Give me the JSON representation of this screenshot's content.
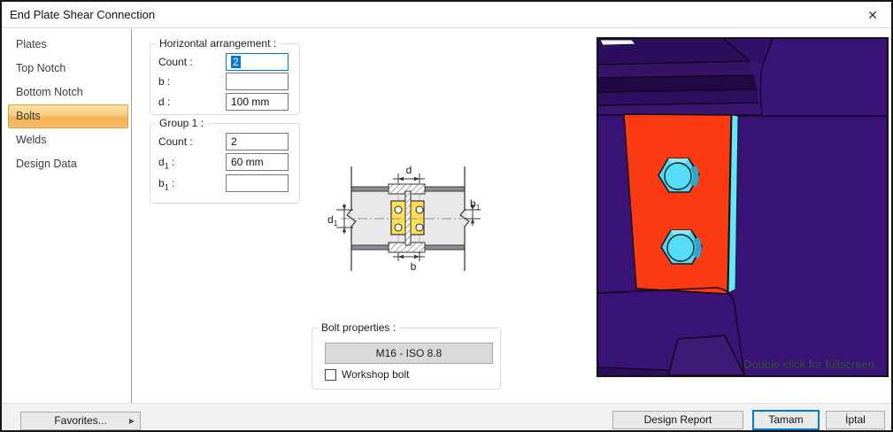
{
  "window": {
    "title": "End Plate Shear Connection",
    "close_icon": "✕"
  },
  "sidebar": {
    "items": [
      {
        "label": "Plates",
        "selected": false
      },
      {
        "label": "Top Notch",
        "selected": false
      },
      {
        "label": "Bottom Notch",
        "selected": false
      },
      {
        "label": "Bolts",
        "selected": true
      },
      {
        "label": "Welds",
        "selected": false
      },
      {
        "label": "Design Data",
        "selected": false
      }
    ]
  },
  "form": {
    "horizontal_group": {
      "title": "Horizontal arrangement :",
      "count": {
        "label": "Count :",
        "value": "2",
        "focused": true
      },
      "b": {
        "label": "b :",
        "value": ""
      },
      "d": {
        "label": "d :",
        "value": "100 mm"
      }
    },
    "group1": {
      "title": "Group 1 :",
      "count": {
        "label": "Count :",
        "value": "2"
      },
      "d1": {
        "label_base": "d",
        "label_sub": "1",
        "label_suffix": " :",
        "value": "60 mm"
      },
      "b1": {
        "label_base": "b",
        "label_sub": "1",
        "label_suffix": " :",
        "value": ""
      }
    },
    "bolt_properties": {
      "title": "Bolt properties :",
      "bolt_button_label": "M16 - ISO 8.8",
      "workshop_checkbox_label": "Workshop bolt",
      "workshop_checked": false
    }
  },
  "diagram": {
    "dim_d": "d",
    "dim_b": "b",
    "dim_d1_base": "d",
    "dim_d1_sub": "1",
    "dim_b1_base": "b",
    "dim_b1_sub": "1"
  },
  "viewport": {
    "overlay_text": "Double click for fullscreen.",
    "colors": {
      "background": "#3A1377",
      "plate_orange": "#FC3B12",
      "bolt_cyan": "#4FD9F4",
      "edge_strip_cyan": "#63E8FB",
      "overlay_text_green": "#2E5430"
    }
  },
  "footer": {
    "favorites": {
      "label": "Favorites...",
      "arrow": "▶"
    },
    "design_report_label": "Design Report",
    "ok_label": "Tamam",
    "cancel_label": "İptal"
  }
}
